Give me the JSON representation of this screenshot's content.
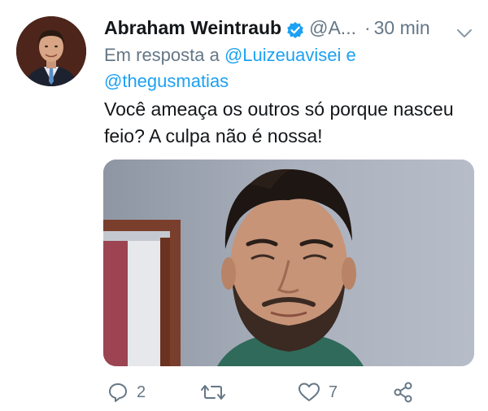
{
  "author": {
    "name": "Abraham Weintraub",
    "handle": "@A...",
    "separator": "·",
    "time": "30 min"
  },
  "reply": {
    "prefix": "Em resposta a",
    "user1": "@Luizeuavisei",
    "joiner": "e",
    "user2": "@thegusmatias"
  },
  "tweet": {
    "text": "Você ameaça os outros só porque nasceu feio? A culpa não é nossa!"
  },
  "actions": {
    "reply_count": "2",
    "retweet_count": "",
    "like_count": "7"
  },
  "colors": {
    "link": "#1da1f2",
    "secondary_text": "#657786",
    "primary_text": "#14171a",
    "verified": "#1da1f2"
  },
  "icons": {
    "verified": "verified-badge-icon",
    "more": "chevron-down-icon",
    "reply": "comment-bubble-icon",
    "retweet": "retweet-icon",
    "like": "heart-outline-icon",
    "share": "share-nodes-icon"
  }
}
